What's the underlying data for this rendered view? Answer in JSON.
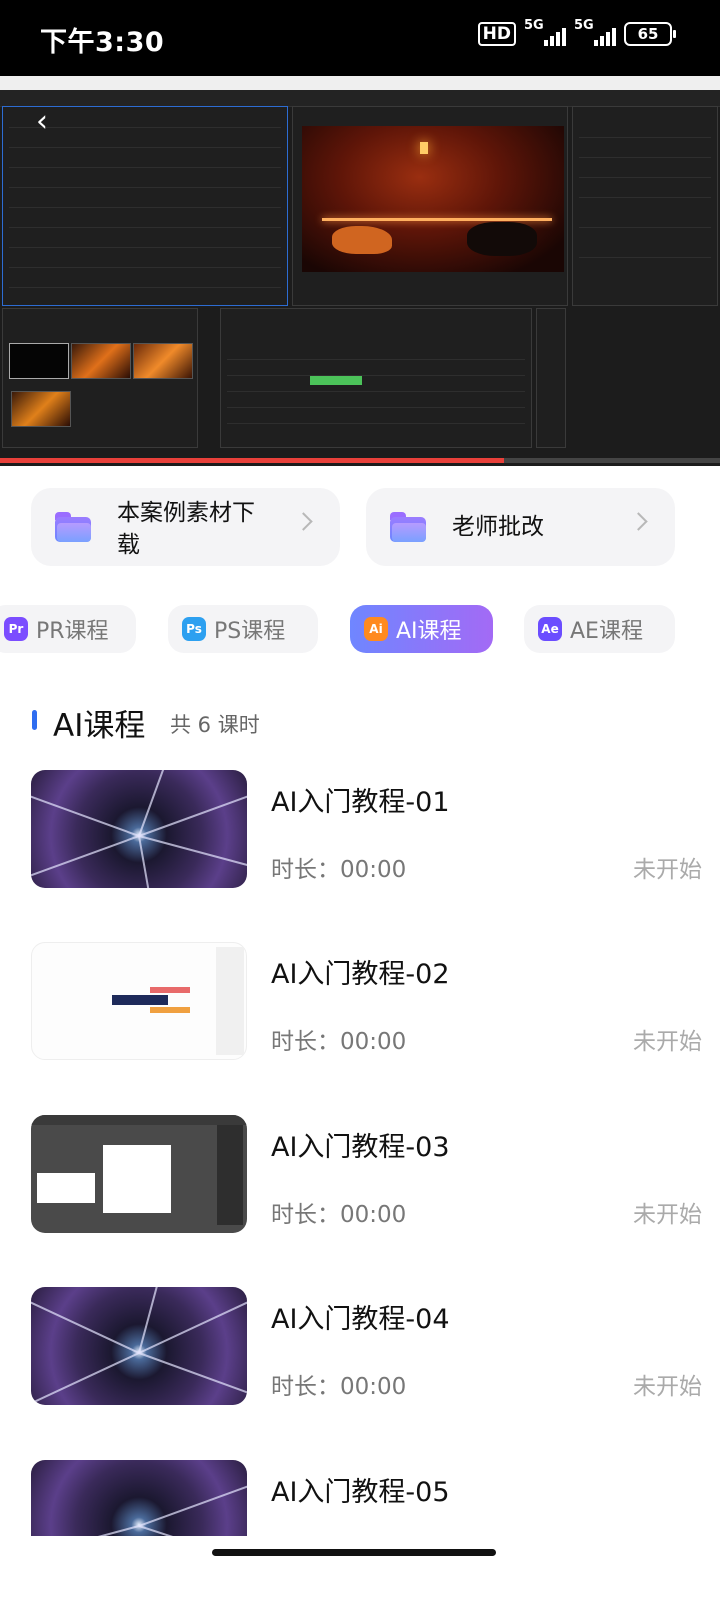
{
  "status_bar": {
    "time": "下午3:30",
    "hd_label": "HD",
    "signal_1": "5G",
    "signal_2": "5G",
    "battery": "65"
  },
  "video": {
    "progress": 0.7
  },
  "actions": [
    {
      "label_line1": "本案例素材下",
      "label_line2": "载",
      "icon": "folder-icon"
    },
    {
      "label": "老师批改",
      "icon": "folder-icon"
    }
  ],
  "categories": [
    {
      "label": "PR课程",
      "icon_text": "Pr",
      "icon_color": "#7b4dff",
      "active": false
    },
    {
      "label": "PS课程",
      "icon_text": "Ps",
      "icon_color": "#2da0f0",
      "active": false
    },
    {
      "label": "AI课程",
      "icon_text": "Ai",
      "icon_color": "#ff8a1f",
      "active": true
    },
    {
      "label": "AE课程",
      "icon_text": "Ae",
      "icon_color": "#6b4dff",
      "active": false
    }
  ],
  "section": {
    "title": "AI课程",
    "count": "共 6 课时"
  },
  "lessons": [
    {
      "title": "AI入门教程-01",
      "duration": "时长：00:00",
      "status": "未开始"
    },
    {
      "title": "AI入门教程-02",
      "duration": "时长：00:00",
      "status": "未开始"
    },
    {
      "title": "AI入门教程-03",
      "duration": "时长：00:00",
      "status": "未开始"
    },
    {
      "title": "AI入门教程-04",
      "duration": "时长：00:00",
      "status": "未开始"
    },
    {
      "title": "AI入门教程-05",
      "duration": "",
      "status": ""
    }
  ],
  "colors": {
    "accent": "#2f6df0",
    "active_tab_start": "#6f86ff",
    "active_tab_end": "#a36af5",
    "progress": "#e8403a"
  }
}
